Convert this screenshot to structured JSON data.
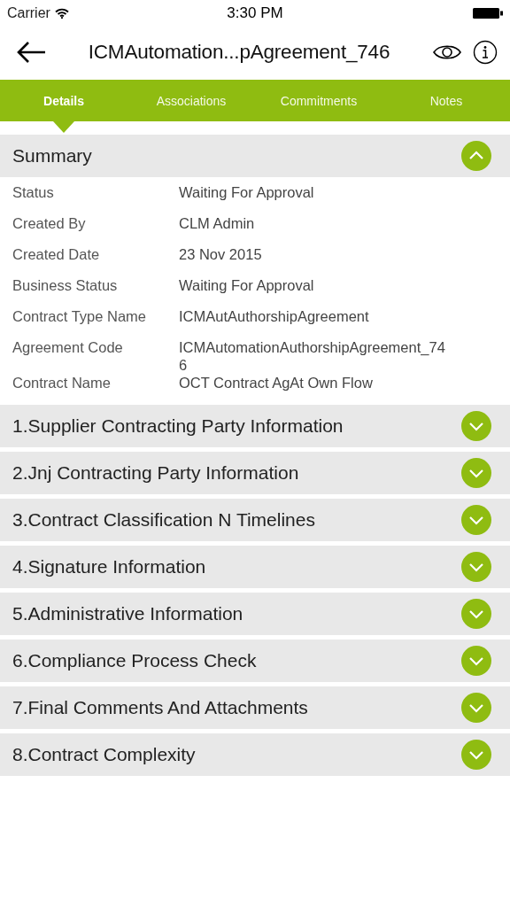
{
  "status_bar": {
    "carrier": "Carrier",
    "time": "3:30 PM"
  },
  "header": {
    "title": "ICMAutomation...pAgreement_746"
  },
  "tabs": [
    {
      "label": "Details",
      "selected": true
    },
    {
      "label": "Associations",
      "selected": false
    },
    {
      "label": "Commitments",
      "selected": false
    },
    {
      "label": "Notes",
      "selected": false
    }
  ],
  "sections": [
    {
      "title": "Summary",
      "expanded": true,
      "fields": [
        {
          "label": "Status",
          "value": "Waiting For Approval"
        },
        {
          "label": "Created By",
          "value": "CLM Admin"
        },
        {
          "label": "Created Date",
          "value": "23 Nov 2015"
        },
        {
          "label": "Business Status",
          "value": "Waiting For Approval"
        },
        {
          "label": "Contract Type Name",
          "value": "ICMAutAuthorshipAgreement"
        },
        {
          "label": "Agreement Code",
          "value": "ICMAutomationAuthorshipAgreement_746"
        },
        {
          "label": "Contract Name",
          "value": "OCT Contract AgAt Own Flow"
        }
      ]
    },
    {
      "title": "1.Supplier Contracting Party Information",
      "expanded": false
    },
    {
      "title": "2.Jnj Contracting Party Information",
      "expanded": false
    },
    {
      "title": "3.Contract Classification N Timelines",
      "expanded": false
    },
    {
      "title": "4.Signature Information",
      "expanded": false
    },
    {
      "title": "5.Administrative Information",
      "expanded": false
    },
    {
      "title": "6.Compliance Process Check",
      "expanded": false
    },
    {
      "title": "7.Final Comments And Attachments",
      "expanded": false
    },
    {
      "title": "8.Contract Complexity",
      "expanded": false
    }
  ]
}
